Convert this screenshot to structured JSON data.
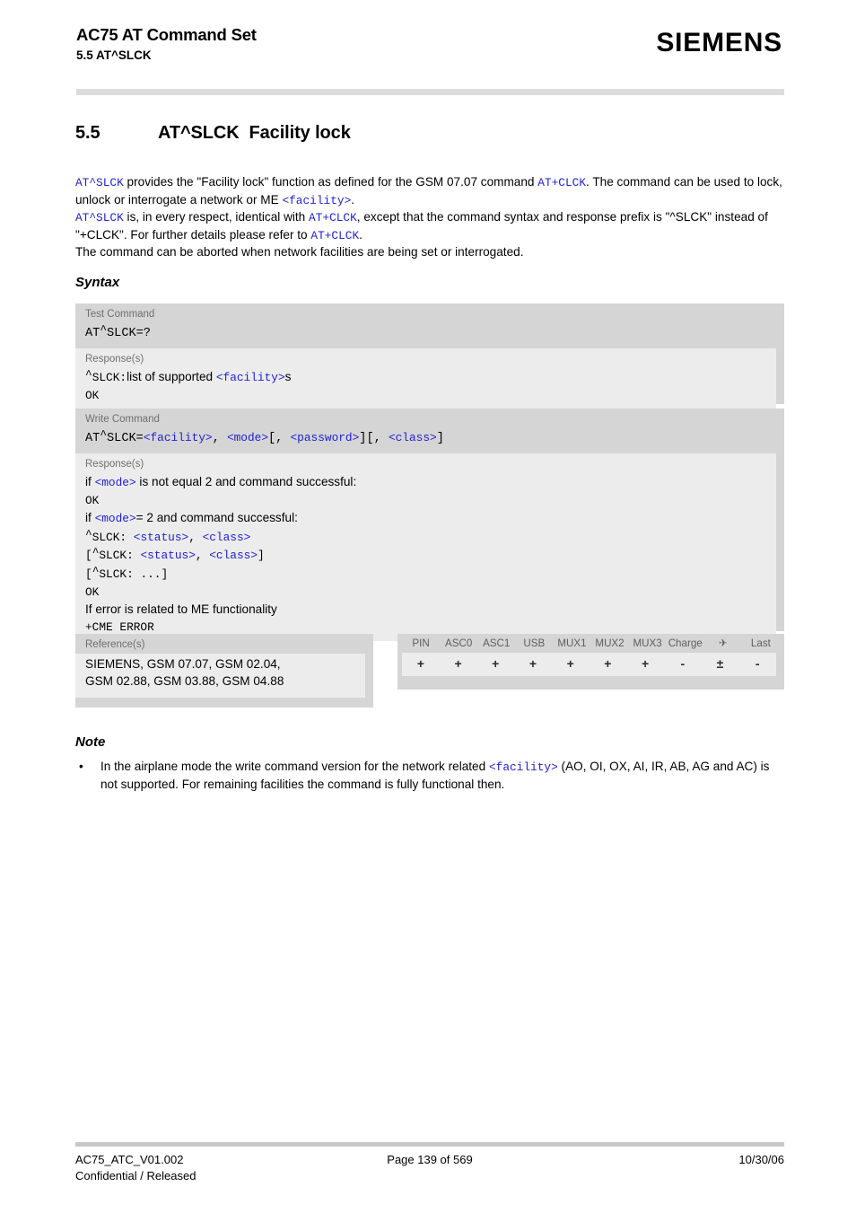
{
  "header": {
    "title": "AC75 AT Command Set",
    "subtitle": "5.5 AT^SLCK",
    "logo": "SIEMENS"
  },
  "section": {
    "number": "5.5",
    "command": "AT^SLCK",
    "title": "Facility lock",
    "heading_full": "5.5    AT^SLCK   Facility lock"
  },
  "intro": {
    "line1_cmd": "AT^SLCK",
    "line1_a": " provides the \"Facility lock\" function as defined for the GSM 07.07 command ",
    "line1_ref": "AT+CLCK",
    "line1_b": ". The command can be used to lock, unlock or interrogate a network or ME ",
    "line1_param": "<facility>",
    "line1_c": ".",
    "line2_cmd": "AT^SLCK",
    "line2_a": " is, in every respect, identical with ",
    "line2_ref": "AT+CLCK",
    "line2_b": ", except that the command syntax and response prefix is \"^SLCK\" instead of \"+CLCK\". For further details please refer to ",
    "line2_ref2": "AT+CLCK",
    "line2_c": ".",
    "line3": "The command can be aborted when network facilities are being set or interrogated."
  },
  "syntax": {
    "label": "Syntax",
    "test": {
      "band_label": "Test Command",
      "command_prefix": "AT",
      "command_caret": "^",
      "command_rest": "SLCK=?",
      "response_label": "Response(s)",
      "resp_prefix_caret": "^",
      "resp_prefix": "SLCK:",
      "resp_text": "list of supported ",
      "resp_param": "<facility>",
      "resp_suffix": "s",
      "resp_ok": "OK"
    },
    "write": {
      "band_label": "Write Command",
      "cmd_prefix": "AT",
      "cmd_caret": "^",
      "cmd_rest": "SLCK=",
      "cmd_p1": "<facility>",
      "cmd_sep1": ", ",
      "cmd_p2": "<mode>",
      "cmd_br1": "[, ",
      "cmd_p3": "<password>",
      "cmd_br2": "][, ",
      "cmd_p4": "<class>",
      "cmd_br3": "]",
      "response_label": "Response(s)",
      "r1_a": "if ",
      "r1_p": "<mode>",
      "r1_b": " is not equal 2 and command successful:",
      "r2": "OK",
      "r3_a": "if ",
      "r3_p": "<mode>",
      "r3_b": "= 2 and command successful:",
      "r4_caret": "^",
      "r4_prefix": "SLCK: ",
      "r4_p1": "<status>",
      "r4_sep": ", ",
      "r4_p2": "<class>",
      "r5_open": "[",
      "r5_caret": "^",
      "r5_prefix": "SLCK: ",
      "r5_p1": "<status>",
      "r5_sep": ", ",
      "r5_p2": "<class>",
      "r5_close": "]",
      "r6_open": "[",
      "r6_caret": "^",
      "r6_prefix": "SLCK: ",
      "r6_dots": "...]",
      "r7": "OK",
      "r8": "If error is related to ME functionality",
      "r9": "+CME ERROR"
    }
  },
  "reference": {
    "label": "Reference(s)",
    "line1": "SIEMENS, GSM 07.07, GSM 02.04,",
    "line2": "GSM 02.88, GSM 03.88, GSM 04.88"
  },
  "capability_table": {
    "columns": [
      "PIN",
      "ASC0",
      "ASC1",
      "USB",
      "MUX1",
      "MUX2",
      "MUX3",
      "Charge",
      "airplane-icon",
      "Last"
    ],
    "airplane_glyph": "✈",
    "values": [
      "+",
      "+",
      "+",
      "+",
      "+",
      "+",
      "+",
      "-",
      "±",
      "-"
    ]
  },
  "note": {
    "heading": "Note",
    "bullet_symbol": "•",
    "text_a": "In the airplane mode the write command version for the network related ",
    "text_param": "<facility>",
    "text_b": " (AO, OI, OX, AI, IR, AB, AG and AC) is not supported. For remaining facilities the command is fully functional then."
  },
  "footer": {
    "doc_id": "AC75_ATC_V01.002",
    "page": "Page 139 of 569",
    "date": "10/30/06",
    "classification": "Confidential / Released"
  },
  "colors": {
    "param_blue": "#2121d6",
    "band_gray": "#d5d5d5",
    "inner_gray": "#ececec",
    "label_gray": "#6f6f6f"
  }
}
